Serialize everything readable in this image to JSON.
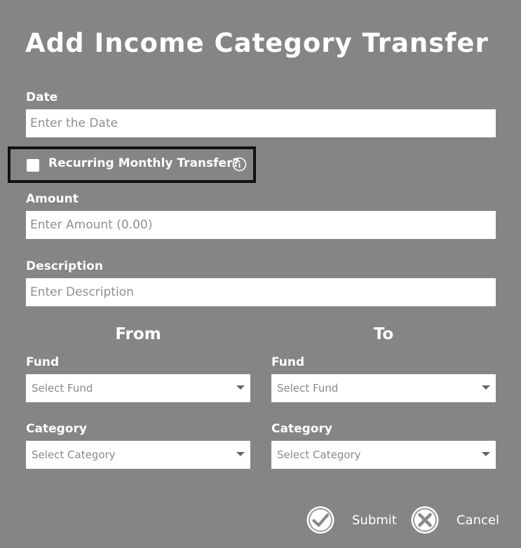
{
  "dialog": {
    "title": "Add Income Category Transfer"
  },
  "date": {
    "label": "Date",
    "placeholder": "Enter the Date",
    "value": ""
  },
  "recurring": {
    "label": "Recurring Monthly Transfer?",
    "checked": false,
    "info_icon": "info-circle-icon"
  },
  "amount": {
    "label": "Amount",
    "placeholder": "Enter Amount (0.00)",
    "value": ""
  },
  "description": {
    "label": "Description",
    "placeholder": "Enter Description",
    "value": ""
  },
  "from": {
    "heading": "From",
    "fund_label": "Fund",
    "fund_value": "Select Fund",
    "category_label": "Category",
    "category_value": "Select Category"
  },
  "to": {
    "heading": "To",
    "fund_label": "Fund",
    "fund_value": "Select Fund",
    "category_label": "Category",
    "category_value": "Select Category"
  },
  "actions": {
    "submit_label": "Submit",
    "submit_icon": "check-circle-icon",
    "cancel_label": "Cancel",
    "cancel_icon": "close-circle-icon"
  },
  "colors": {
    "background": "#858585",
    "input_background": "#ffffff",
    "highlight_border": "#111111"
  }
}
